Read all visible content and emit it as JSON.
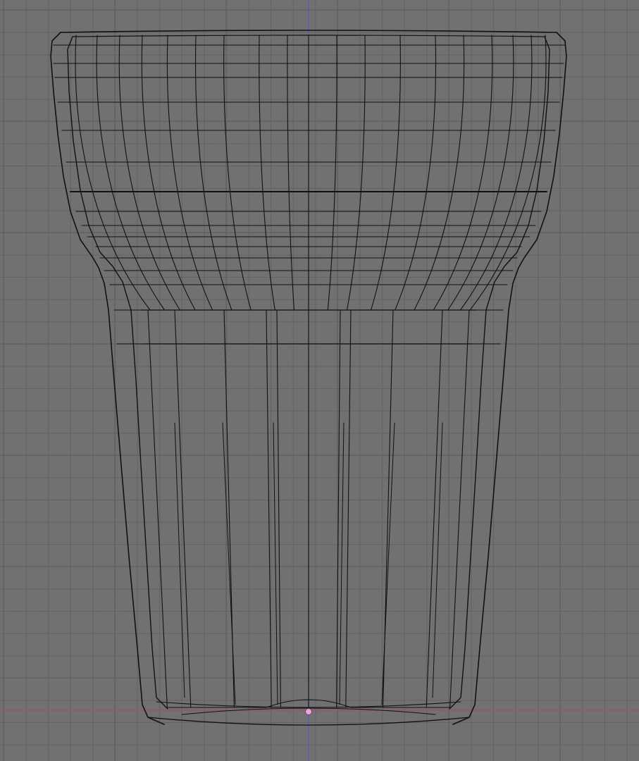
{
  "viewport": {
    "view": "front-orthographic",
    "shading": "wireframe",
    "grid": true,
    "colors": {
      "background": "#717171",
      "grid_line": "#5f5f5f",
      "wire": "#111111",
      "axis_x": "#b34a4a",
      "axis_z": "#5b56c2",
      "origin_point": "#e3a8d8"
    }
  },
  "object": {
    "type": "mesh",
    "shape": "drinking-glass",
    "display": "wireframe"
  }
}
